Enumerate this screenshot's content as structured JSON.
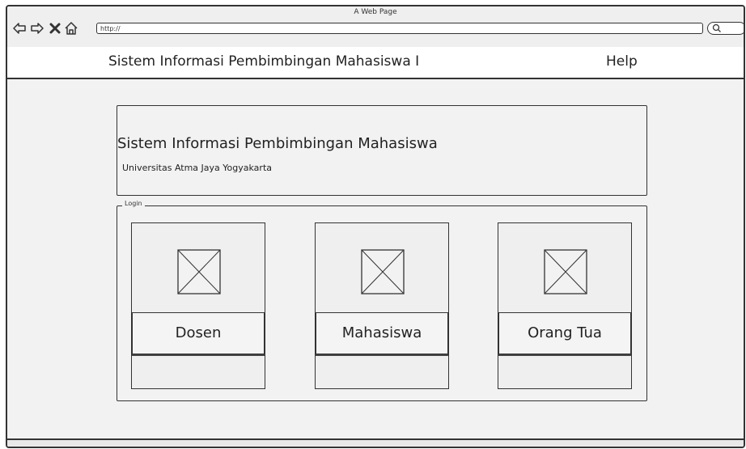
{
  "browser": {
    "window_title": "A Web Page",
    "url": "http://"
  },
  "menubar": {
    "app_title": "Sistem Informasi Pembimbingan Mahasiswa I",
    "help_label": "Help"
  },
  "header": {
    "title": "Sistem Informasi Pembimbingan Mahasiswa",
    "subtitle": "Universitas Atma Jaya Yogyakarta"
  },
  "login": {
    "legend": "Login",
    "options": [
      {
        "label": "Dosen",
        "icon": "image-placeholder-icon"
      },
      {
        "label": "Mahasiswa",
        "icon": "image-placeholder-icon"
      },
      {
        "label": "Orang Tua",
        "icon": "image-placeholder-icon"
      }
    ]
  },
  "icons": {
    "back": "arrow-left-icon",
    "forward": "arrow-right-icon",
    "stop": "close-icon",
    "home": "home-icon",
    "search": "search-icon"
  }
}
